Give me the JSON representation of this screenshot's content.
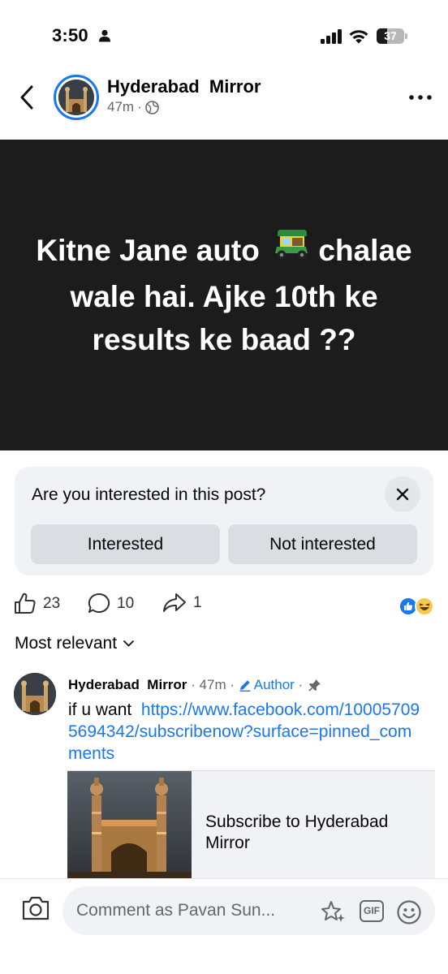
{
  "status_bar": {
    "time": "3:50",
    "battery": "37",
    "battery_level": 0.37
  },
  "header": {
    "page_name": "Hyderabad  Mirror",
    "post_time": "47m",
    "separator": "·"
  },
  "post": {
    "text": "Kitne Jane auto",
    "text_rest": "chalae wale hai. Ajke 10th ke results ke baad ??",
    "background_color": "#1c1c1c"
  },
  "interest_prompt": {
    "question": "Are you interested in this post?",
    "interested_label": "Interested",
    "not_interested_label": "Not interested"
  },
  "actions": {
    "like_count": "23",
    "comment_count": "10",
    "share_count": "1"
  },
  "sort": {
    "label": "Most relevant"
  },
  "comment": {
    "author": "Hyderabad  Mirror",
    "time": "47m",
    "role": "Author",
    "text": "if u want",
    "link": "https://www.facebook.com/100057095694342/subscribenow?surface=pinned_comments",
    "preview_title": "Subscribe to Hyderabad Mirror"
  },
  "composer": {
    "placeholder": "Comment as Pavan Sun...",
    "gif_label": "GIF"
  },
  "colors": {
    "accent": "#1877f2",
    "secondary_text": "#65676b",
    "card_background": "#f0f2f5",
    "button_background": "#dadde1"
  }
}
